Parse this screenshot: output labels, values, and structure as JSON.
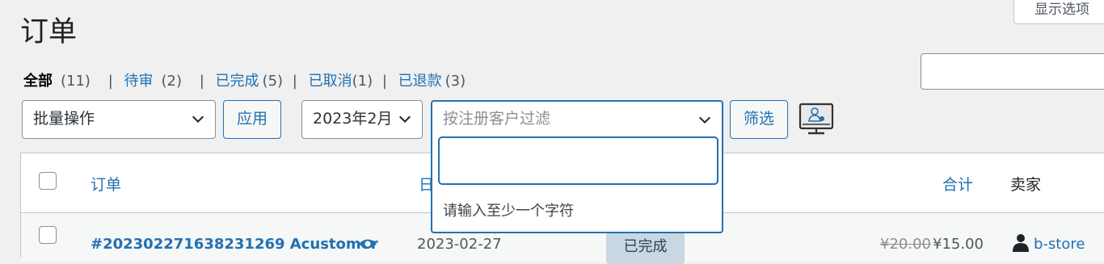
{
  "header": {
    "screen_options_label": "显示选项",
    "title": "订单"
  },
  "views": [
    {
      "label": "全部",
      "count": "(11)",
      "current": true
    },
    {
      "label": "待审",
      "count": "(2)"
    },
    {
      "label": "已完成",
      "count": "(5)"
    },
    {
      "label": "已取消",
      "count": "(1)"
    },
    {
      "label": "已退款",
      "count": "(3)"
    }
  ],
  "view_separator": "|",
  "filters": {
    "bulk_action": "批量操作",
    "apply_label": "应用",
    "month": "2023年2月",
    "customer_placeholder": "按注册客户过滤",
    "customer_dropdown_message": "请输入至少一个字符",
    "filter_label": "筛选",
    "remote_icon": "remote-support-icon"
  },
  "table": {
    "columns": {
      "order": "订单",
      "date": "日",
      "total": "合计",
      "seller": "卖家"
    },
    "rows": [
      {
        "order": "#202302271638231269 Acustomer",
        "date": "2023-02-27",
        "status": "已完成",
        "total_old": "¥20.00",
        "total_new": "¥15.00",
        "seller": "b-store"
      }
    ]
  },
  "colors": {
    "accent": "#2271b1",
    "background": "#f0f0f1",
    "status_completed_bg": "#c8d7e1"
  }
}
